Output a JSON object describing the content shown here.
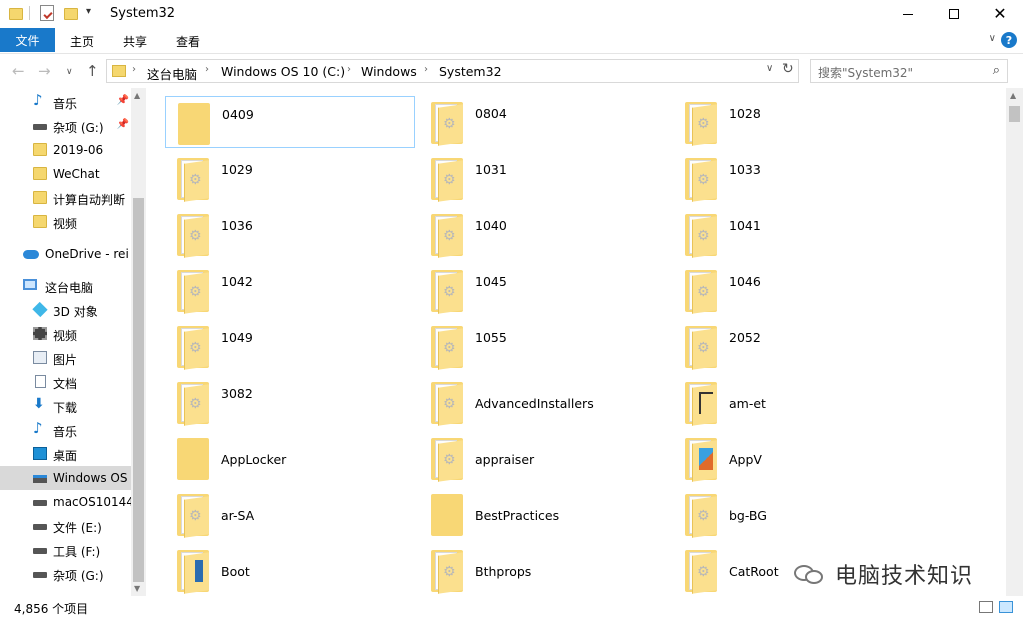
{
  "window": {
    "title": "System32"
  },
  "ribbon": {
    "tabs": [
      {
        "label": "文件"
      },
      {
        "label": "主页"
      },
      {
        "label": "共享"
      },
      {
        "label": "查看"
      }
    ]
  },
  "address": {
    "crumbs": [
      "这台电脑",
      "Windows OS 10 (C:)",
      "Windows",
      "System32"
    ]
  },
  "search": {
    "placeholder": "搜索\"System32\""
  },
  "sidebar": {
    "items": [
      {
        "label": "音乐",
        "icon": "music-icon",
        "pinned": true
      },
      {
        "label": "杂项 (G:)",
        "icon": "drive-icon",
        "pinned": true
      },
      {
        "label": "2019-06",
        "icon": "folder-icon"
      },
      {
        "label": "WeChat",
        "icon": "folder-icon"
      },
      {
        "label": "计算自动判断",
        "icon": "folder-icon"
      },
      {
        "label": "视频",
        "icon": "folder-icon"
      },
      {
        "label": "OneDrive - rei",
        "icon": "onedrive-icon"
      },
      {
        "label": "这台电脑",
        "icon": "this-pc-icon"
      },
      {
        "label": "3D 对象",
        "icon": "3d-objects-icon"
      },
      {
        "label": "视频",
        "icon": "videos-icon"
      },
      {
        "label": "图片",
        "icon": "pictures-icon"
      },
      {
        "label": "文档",
        "icon": "documents-icon"
      },
      {
        "label": "下载",
        "icon": "downloads-icon"
      },
      {
        "label": "音乐",
        "icon": "music-icon"
      },
      {
        "label": "桌面",
        "icon": "desktop-icon"
      },
      {
        "label": "Windows OS",
        "icon": "windows-drive-icon",
        "selected": true
      },
      {
        "label": "macOS10144",
        "icon": "drive-icon"
      },
      {
        "label": "文件 (E:)",
        "icon": "drive-icon"
      },
      {
        "label": "工具 (F:)",
        "icon": "drive-icon"
      },
      {
        "label": "杂项 (G:)",
        "icon": "drive-icon"
      }
    ]
  },
  "files": [
    {
      "name": "0409",
      "icon": "folder-icon"
    },
    {
      "name": "0804",
      "icon": "folder-gear-icon"
    },
    {
      "name": "1028",
      "icon": "folder-gear-icon"
    },
    {
      "name": "1029",
      "icon": "folder-gear-icon"
    },
    {
      "name": "1031",
      "icon": "folder-gear-icon"
    },
    {
      "name": "1033",
      "icon": "folder-gear-icon"
    },
    {
      "name": "1036",
      "icon": "folder-gear-icon"
    },
    {
      "name": "1040",
      "icon": "folder-gear-icon"
    },
    {
      "name": "1041",
      "icon": "folder-gear-icon"
    },
    {
      "name": "1042",
      "icon": "folder-gear-icon"
    },
    {
      "name": "1045",
      "icon": "folder-gear-icon"
    },
    {
      "name": "1046",
      "icon": "folder-gear-icon"
    },
    {
      "name": "1049",
      "icon": "folder-gear-icon"
    },
    {
      "name": "1055",
      "icon": "folder-gear-icon"
    },
    {
      "name": "2052",
      "icon": "folder-gear-icon"
    },
    {
      "name": "3082",
      "icon": "folder-gear-icon"
    },
    {
      "name": "AdvancedInstallers",
      "icon": "folder-gear-icon"
    },
    {
      "name": "am-et",
      "icon": "folder-network-icon"
    },
    {
      "name": "AppLocker",
      "icon": "folder-icon"
    },
    {
      "name": "appraiser",
      "icon": "folder-gear-icon"
    },
    {
      "name": "AppV",
      "icon": "folder-appv-icon"
    },
    {
      "name": "ar-SA",
      "icon": "folder-gear-icon"
    },
    {
      "name": "BestPractices",
      "icon": "folder-icon"
    },
    {
      "name": "bg-BG",
      "icon": "folder-gear-icon"
    },
    {
      "name": "Boot",
      "icon": "folder-boot-icon"
    },
    {
      "name": "Bthprops",
      "icon": "folder-gear-icon"
    },
    {
      "name": "CatRoot",
      "icon": "folder-gear-icon"
    }
  ],
  "status": {
    "count": "4,856 个项目"
  },
  "watermark": {
    "text": "电脑技术知识"
  }
}
